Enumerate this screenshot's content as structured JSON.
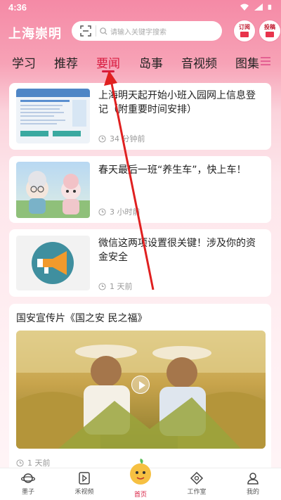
{
  "status": {
    "time": "4:36"
  },
  "header": {
    "logo": "上海崇明",
    "search_placeholder": "请输入关键字搜索",
    "btn_left": "订阅",
    "btn_right": "投稿"
  },
  "tabs": [
    "学习",
    "推荐",
    "要闻",
    "岛事",
    "音视频",
    "图集"
  ],
  "active_tab": "要闻",
  "articles": [
    {
      "title": "上海明天起开始小班入园网上信息登记（附重要时间安排）",
      "time": "34 分钟前"
    },
    {
      "title": "春天最后一班“养生车”，快上车！",
      "time": "3 小时前"
    },
    {
      "title": "微信这两项设置很关键！涉及你的资金安全",
      "time": "1 天前"
    }
  ],
  "video_card": {
    "title": "国安宣传片《国之安 民之福》",
    "time": "1 天前"
  },
  "nav": [
    "墨子",
    "禾视频",
    "首页",
    "工作室",
    "我的"
  ],
  "colors": {
    "accent": "#d81b3f",
    "gradient_top": "#f58aa6"
  }
}
